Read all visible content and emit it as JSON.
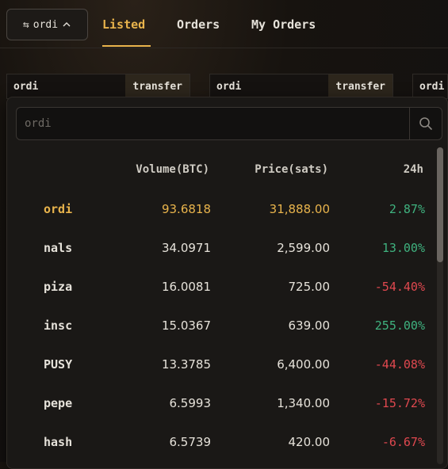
{
  "token_switch": {
    "label": "ordi"
  },
  "tabs": [
    {
      "label": "Listed",
      "active": true
    },
    {
      "label": "Orders",
      "active": false
    },
    {
      "label": "My Orders",
      "active": false
    }
  ],
  "cards": [
    {
      "name": "ordi",
      "action": "transfer"
    },
    {
      "name": "ordi",
      "action": "transfer"
    },
    {
      "name": "ordi",
      "action": ""
    }
  ],
  "search": {
    "placeholder": "ordi",
    "value": ""
  },
  "table": {
    "headers": {
      "volume": "Volume(BTC)",
      "price": "Price(sats)",
      "change": "24h"
    },
    "rows": [
      {
        "name": "ordi",
        "volume": "93.6818",
        "price": "31,888.00",
        "change": "2.87%",
        "trend": "up",
        "selected": true
      },
      {
        "name": "nals",
        "volume": "34.0971",
        "price": "2,599.00",
        "change": "13.00%",
        "trend": "up",
        "selected": false
      },
      {
        "name": "piza",
        "volume": "16.0081",
        "price": "725.00",
        "change": "-54.40%",
        "trend": "down",
        "selected": false
      },
      {
        "name": "insc",
        "volume": "15.0367",
        "price": "639.00",
        "change": "255.00%",
        "trend": "up",
        "selected": false
      },
      {
        "name": "PUSY",
        "volume": "13.3785",
        "price": "6,400.00",
        "change": "-44.08%",
        "trend": "down",
        "selected": false
      },
      {
        "name": "pepe",
        "volume": "6.5993",
        "price": "1,340.00",
        "change": "-15.72%",
        "trend": "down",
        "selected": false
      },
      {
        "name": "hash",
        "volume": "6.5739",
        "price": "420.00",
        "change": "-6.67%",
        "trend": "down",
        "selected": false
      }
    ]
  },
  "colors": {
    "accent": "#e9b44c",
    "positive": "#3fb27f",
    "negative": "#e0484f"
  },
  "icons": {
    "switch": "swap-arrows-icon",
    "toggle": "chevron-up-icon",
    "search": "search-icon"
  }
}
